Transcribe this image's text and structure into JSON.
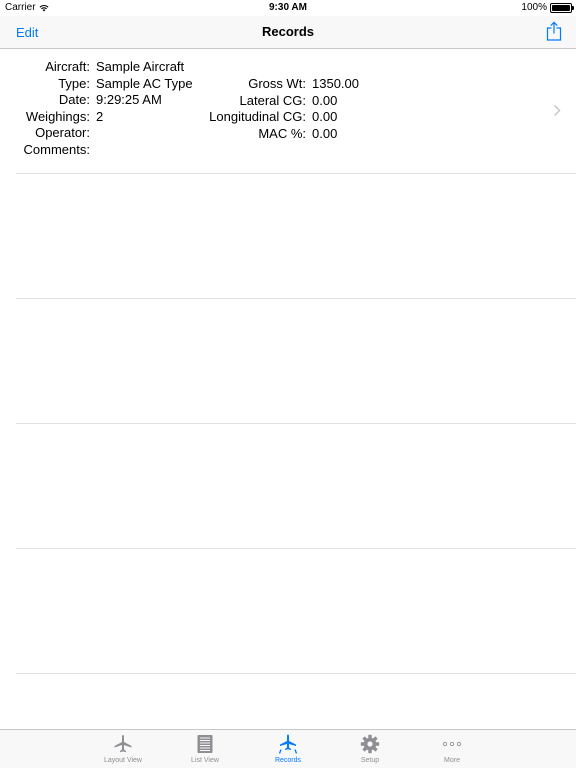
{
  "status_bar": {
    "carrier": "Carrier",
    "time": "9:30 AM",
    "battery": "100%"
  },
  "nav": {
    "edit_label": "Edit",
    "title": "Records"
  },
  "record": {
    "left_labels": [
      "Aircraft:",
      "Type:",
      "Date:",
      "Weighings:",
      "Operator:",
      "Comments:"
    ],
    "left_values": [
      "Sample Aircraft",
      "Sample AC Type",
      "9:29:25 AM",
      "2",
      "",
      ""
    ],
    "right_labels": [
      "Gross Wt:",
      "Lateral CG:",
      "Longitudinal CG:",
      "MAC %:"
    ],
    "right_values": [
      "1350.00",
      "0.00",
      "0.00",
      "0.00"
    ]
  },
  "tabs": [
    {
      "label": "Layout View",
      "icon": "airplane-icon",
      "active": false
    },
    {
      "label": "List View",
      "icon": "list-icon",
      "active": false
    },
    {
      "label": "Records",
      "icon": "records-icon",
      "active": true
    },
    {
      "label": "Setup",
      "icon": "gear-icon",
      "active": false
    },
    {
      "label": "More",
      "icon": "more-icon",
      "active": false
    }
  ],
  "colors": {
    "accent": "#007aff",
    "inactive": "#8e8e93",
    "separator": "#c8c7cc"
  }
}
